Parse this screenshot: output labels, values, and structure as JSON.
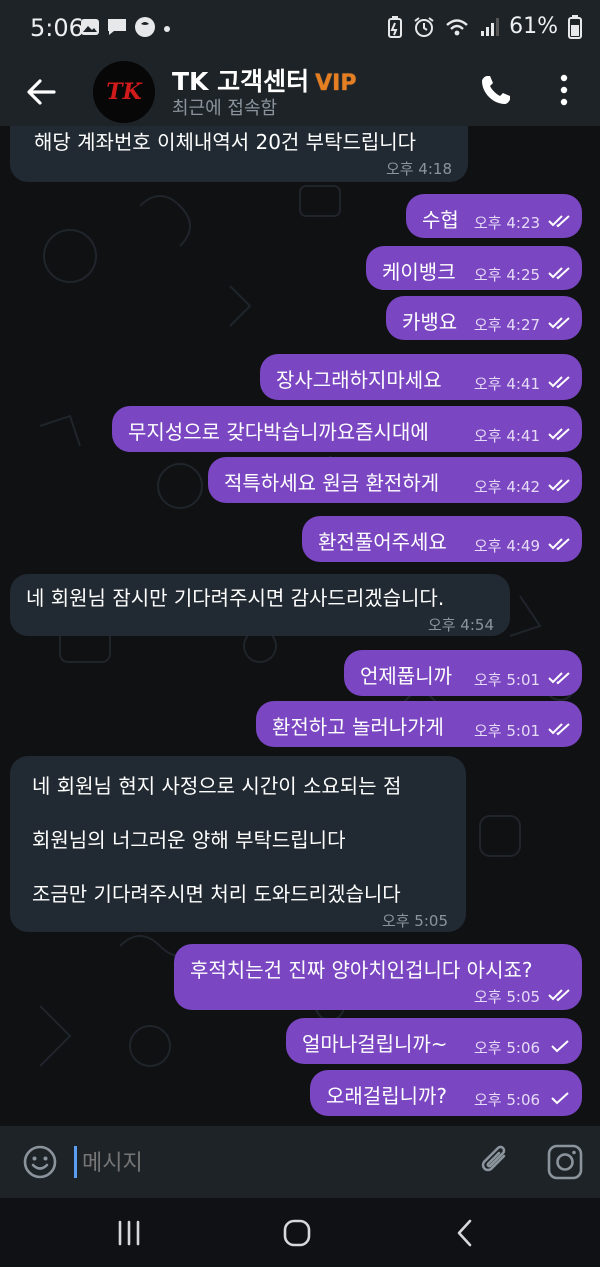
{
  "status_bar": {
    "time": "5:06",
    "battery": "61%"
  },
  "header": {
    "title": "TK 고객센터",
    "badge": "VIP",
    "subtitle": "최근에 접속함",
    "avatar_text": "TK"
  },
  "messages": [
    {
      "text": "해당 계좌번호 이체내역서 20건 부탁드립니다",
      "time": "오후 4:18"
    },
    {
      "text": "수협",
      "time": "오후 4:23"
    },
    {
      "text": "케이뱅크",
      "time": "오후 4:25"
    },
    {
      "text": "카뱅요",
      "time": "오후 4:27"
    },
    {
      "text": "장사그래하지마세요",
      "time": "오후 4:41"
    },
    {
      "text": "무지성으로 갖다박습니까요즘시대에",
      "time": "오후 4:41"
    },
    {
      "text": "적특하세요 원금 환전하게",
      "time": "오후 4:42"
    },
    {
      "text": "환전풀어주세요",
      "time": "오후 4:49"
    },
    {
      "text": "네 회원님 잠시만 기다려주시면 감사드리겠습니다.",
      "time": "오후 4:54"
    },
    {
      "text": "언제풉니까",
      "time": "오후 5:01"
    },
    {
      "text": "환전하고 놀러나가게",
      "time": "오후 5:01"
    },
    {
      "lines": [
        "네 회원님 현지 사정으로 시간이 소요되는 점",
        "회원님의 너그러운 양해 부탁드립니다",
        "조금만 기다려주시면 처리 도와드리겠습니다"
      ],
      "time": "오후 5:05"
    },
    {
      "text": "후적치는건 진짜 양아치인겁니다 아시죠?",
      "time": "오후 5:05"
    },
    {
      "text": "얼마나걸립니까~",
      "time": "오후 5:06"
    },
    {
      "text": "오래걸립니까?",
      "time": "오후 5:06"
    }
  ],
  "input": {
    "placeholder": "메시지"
  },
  "colors": {
    "outgoing_bubble": "#7b46c1",
    "incoming_bubble": "#212a32",
    "background": "#0f1113"
  }
}
